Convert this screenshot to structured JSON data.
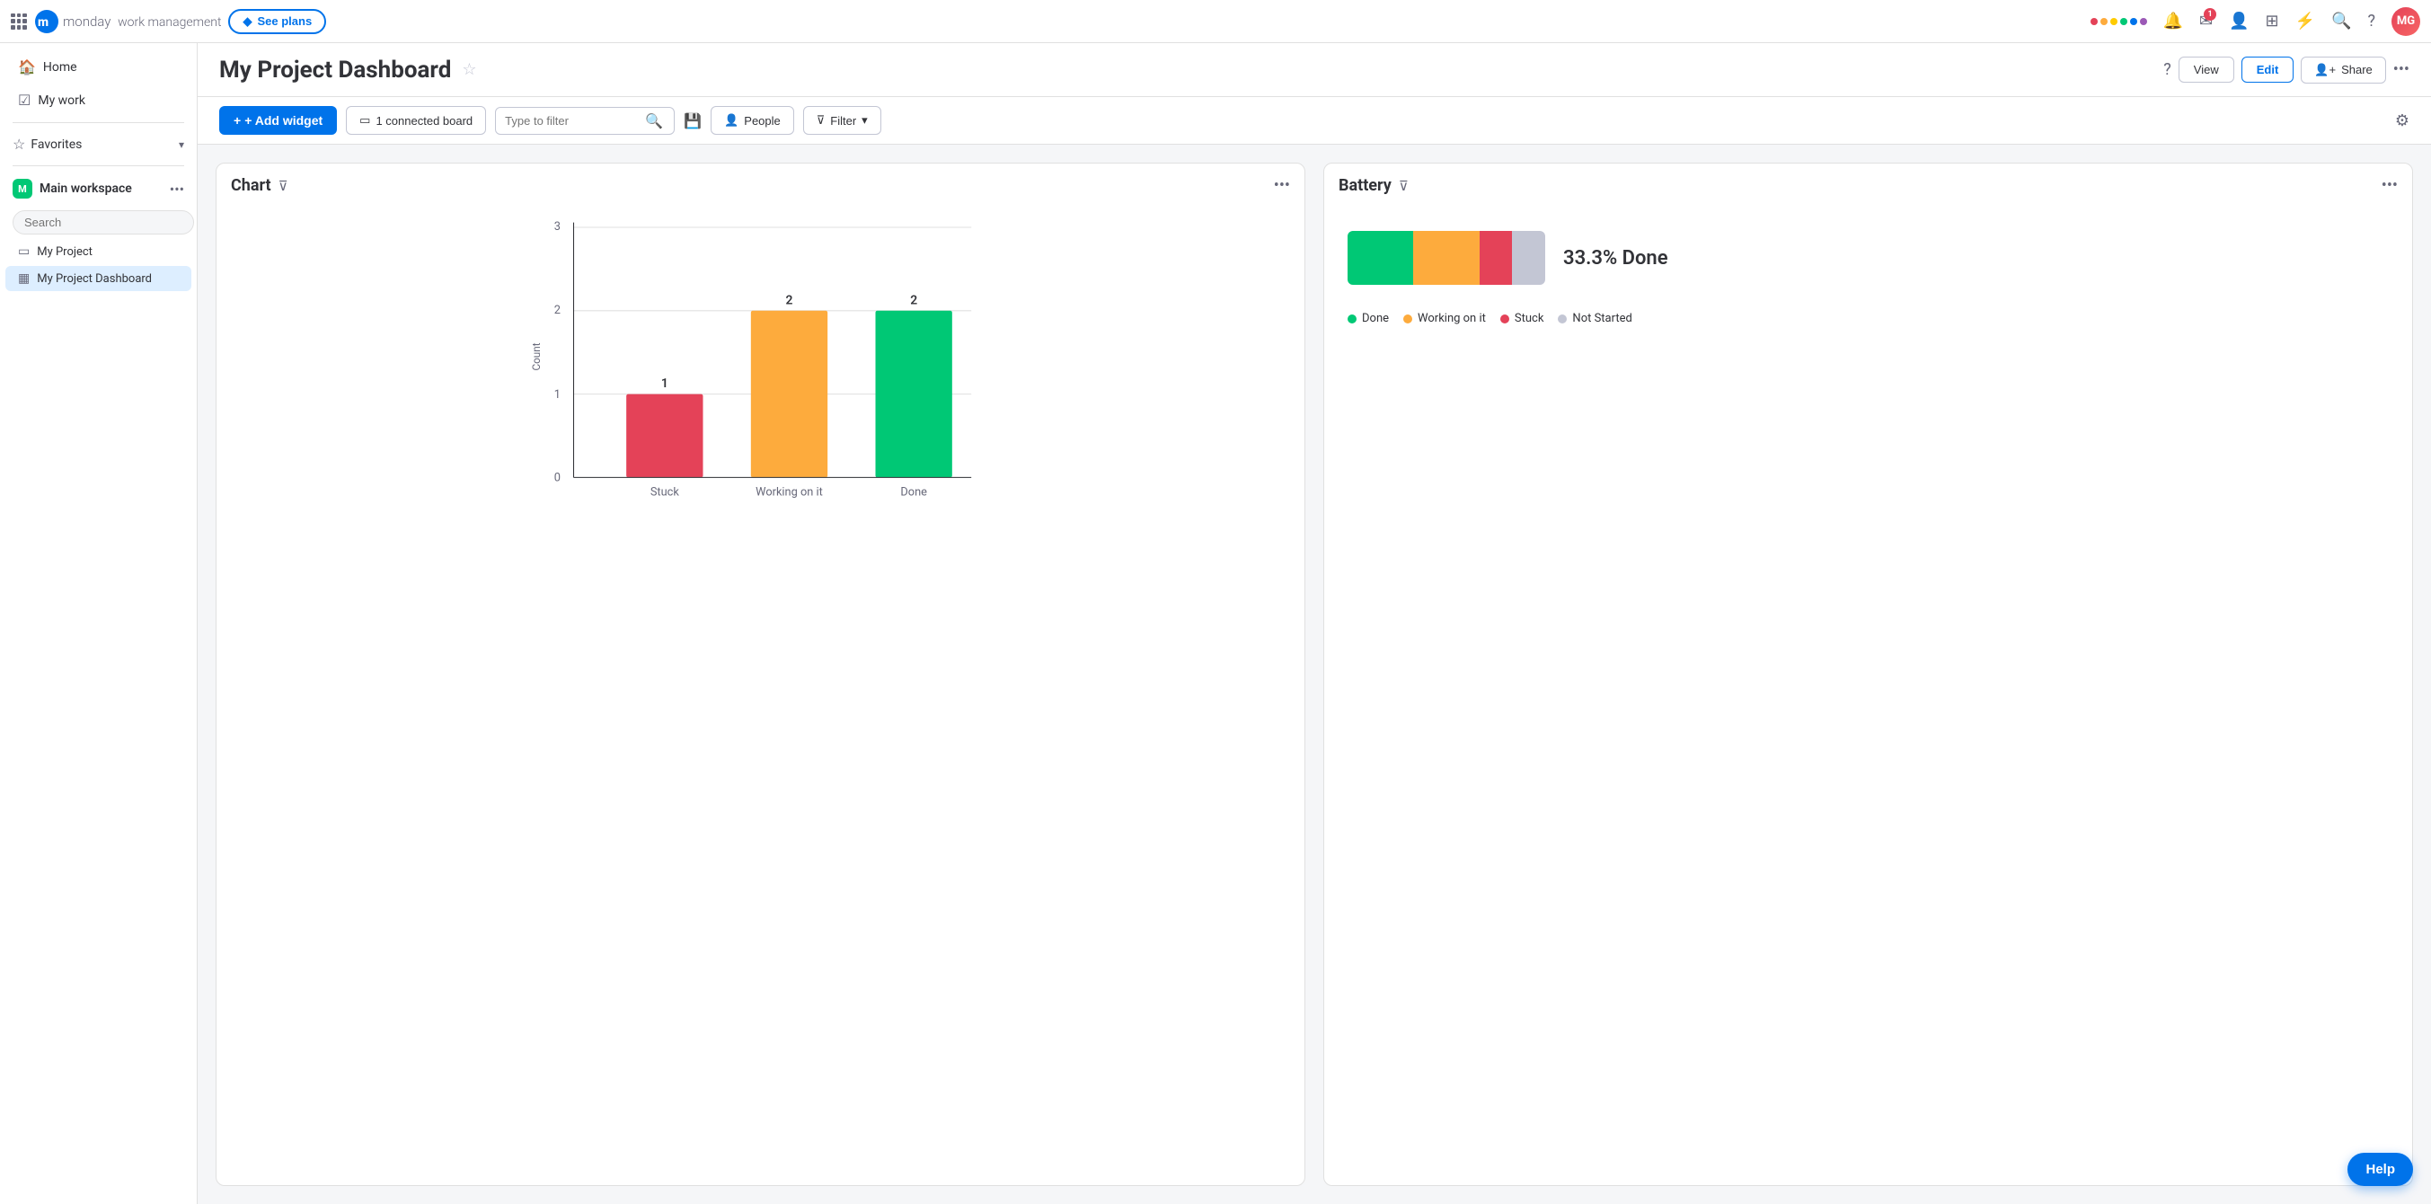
{
  "app": {
    "name": "monday",
    "tagline": "work management",
    "see_plans_label": "See plans"
  },
  "topnav": {
    "notification_icon": "🔔",
    "inbox_icon": "✉",
    "inbox_badge": "1",
    "invite_icon": "👤+",
    "apps_icon": "⊞",
    "integrations_icon": "⚡",
    "search_icon": "🔍",
    "help_icon": "?",
    "avatar_initials": "MG",
    "rainbow_colors": [
      "#e44258",
      "#f76565",
      "#ffcb00",
      "#00c875",
      "#0073ea",
      "#9b59b6"
    ]
  },
  "sidebar": {
    "home_label": "Home",
    "my_work_label": "My work",
    "favorites_label": "Favorites",
    "workspace_name": "Main workspace",
    "workspace_initial": "M",
    "search_placeholder": "Search",
    "items": [
      {
        "id": "my-project",
        "label": "My Project",
        "icon": "▭"
      },
      {
        "id": "my-project-dashboard",
        "label": "My Project Dashboard",
        "icon": "▦",
        "active": true
      }
    ]
  },
  "dashboard": {
    "title": "My Project Dashboard",
    "view_label": "View",
    "edit_label": "Edit",
    "share_label": "Share",
    "share_icon": "👤+"
  },
  "toolbar": {
    "add_widget_label": "+ Add widget",
    "connected_board_label": "1 connected board",
    "filter_placeholder": "Type to filter",
    "people_label": "People",
    "filter_label": "Filter"
  },
  "chart_widget": {
    "title": "Chart",
    "bars": [
      {
        "label": "Stuck",
        "value": 1,
        "color": "#e44258",
        "max": 3
      },
      {
        "label": "Working on it",
        "value": 2,
        "color": "#fdab3d",
        "max": 3
      },
      {
        "label": "Done",
        "value": 2,
        "color": "#00c875",
        "max": 3
      }
    ],
    "y_labels": [
      "0",
      "1",
      "2",
      "3"
    ],
    "y_axis_label": "Count",
    "x_axis_max": 3
  },
  "battery_widget": {
    "title": "Battery",
    "percent_text": "33.3% Done",
    "segments": [
      {
        "label": "Done",
        "color": "#00c875",
        "width": 33.3
      },
      {
        "label": "Working on it",
        "color": "#fdab3d",
        "width": 33.3
      },
      {
        "label": "Stuck",
        "color": "#e44258",
        "width": 16.7
      },
      {
        "label": "Not Started",
        "color": "#c3c6d4",
        "width": 16.7
      }
    ],
    "legend": [
      {
        "label": "Done",
        "color": "#00c875"
      },
      {
        "label": "Working on it",
        "color": "#fdab3d"
      },
      {
        "label": "Stuck",
        "color": "#e44258"
      },
      {
        "label": "Not Started",
        "color": "#c3c6d4"
      }
    ]
  },
  "help_button": {
    "label": "Help"
  }
}
